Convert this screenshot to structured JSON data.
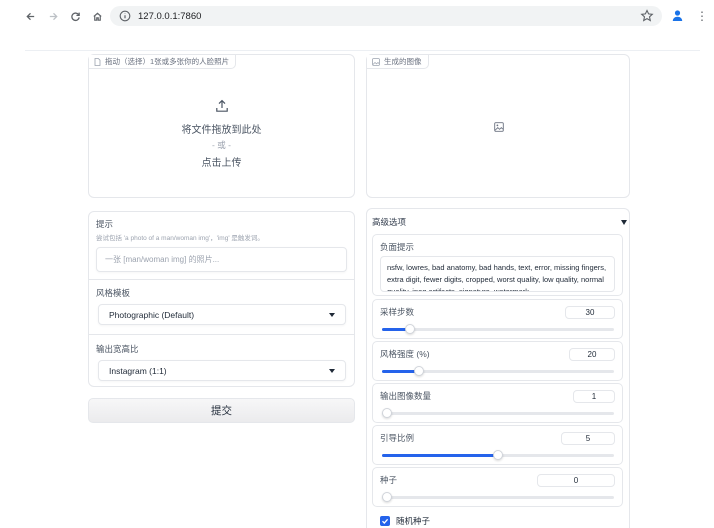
{
  "browser": {
    "url": "127.0.0.1:7860"
  },
  "upload": {
    "tag": "拖动（选择）1张或多张你的人脸照片",
    "drop_text": "将文件拖放到此处",
    "or_text": "- 或 -",
    "click_text": "点击上传"
  },
  "output": {
    "tag": "生成的图像"
  },
  "prompt": {
    "label": "提示",
    "info": "尝试包括 'a photo of a man/woman img'，'img' 是触发词。",
    "placeholder": "一张 [man/woman img] 的照片..."
  },
  "style": {
    "label": "风格模板",
    "value": "Photographic (Default)"
  },
  "aspect": {
    "label": "输出宽高比",
    "value": "Instagram (1:1)"
  },
  "submit_label": "提交",
  "advanced": {
    "title": "高级选项",
    "negative_prompt": {
      "label": "负面提示",
      "value": "nsfw, lowres, bad anatomy, bad hands, text, error, missing fingers, extra digit, fewer digits, cropped, worst quality, low quality, normal quality, jpeg artifacts, signature, watermark"
    },
    "steps": {
      "label": "采样步数",
      "value": "30",
      "level": 0.12
    },
    "style_strength": {
      "label": "风格强度 (%)",
      "value": "20",
      "level": 0.16
    },
    "num_images": {
      "label": "输出图像数量",
      "value": "1",
      "level": 0.0
    },
    "guidance": {
      "label": "引导比例",
      "value": "5",
      "level": 0.5
    },
    "seed": {
      "label": "种子",
      "value": "0",
      "level": 0.0
    },
    "randomize": {
      "label": "随机种子",
      "checked": true
    }
  },
  "colors": {
    "accent": "#2563eb",
    "border": "#e5e7eb"
  }
}
